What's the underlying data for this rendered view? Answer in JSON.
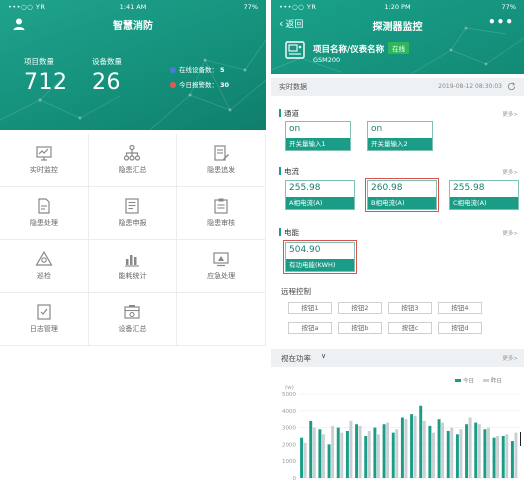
{
  "left": {
    "status": {
      "signal": "•••○○ YR",
      "time": "1:41 AM",
      "battery": "77%"
    },
    "title": "智慧消防",
    "stats": [
      {
        "label": "项目数量",
        "value": "712"
      },
      {
        "label": "设备数量",
        "value": "26"
      }
    ],
    "mini_stats": [
      {
        "label": "在线设备数：",
        "value": "5",
        "color": "#4a7bd8"
      },
      {
        "label": "今日报警数：",
        "value": "30",
        "color": "#e85a4f"
      }
    ],
    "menu": [
      {
        "label": "实时监控",
        "icon": "monitor-icon"
      },
      {
        "label": "隐患汇总",
        "icon": "hierarchy-icon"
      },
      {
        "label": "隐患追发",
        "icon": "edit-doc-icon"
      },
      {
        "label": "隐患处理",
        "icon": "doc-pen-icon"
      },
      {
        "label": "隐患申报",
        "icon": "report-icon"
      },
      {
        "label": "隐患审核",
        "icon": "clipboard-icon"
      },
      {
        "label": "巡检",
        "icon": "warning-icon"
      },
      {
        "label": "能耗统计",
        "icon": "bar-chart-icon"
      },
      {
        "label": "应急处理",
        "icon": "screen-icon"
      },
      {
        "label": "日志管理",
        "icon": "log-icon"
      },
      {
        "label": "设备汇总",
        "icon": "device-icon"
      }
    ]
  },
  "right": {
    "status": {
      "signal": "•••○○ YR",
      "time": "1:20 PM",
      "battery": "77%"
    },
    "back_label": "返回",
    "title": "探测器监控",
    "more_label": "•••",
    "device": {
      "name": "项目名称/仪表名称",
      "status": "在线",
      "model": "GSM200"
    },
    "realtime": {
      "label": "实时数据",
      "timestamp": "2019-08-12 08:30:03"
    },
    "more_link": "更多>",
    "sections": {
      "channel": {
        "title": "通道",
        "items": [
          {
            "value": "on",
            "name": "开关量输入1"
          },
          {
            "value": "on",
            "name": "开关量输入2"
          }
        ]
      },
      "current": {
        "title": "电流",
        "items": [
          {
            "value": "255.98",
            "name": "A相电流(A)"
          },
          {
            "value": "260.98",
            "name": "B相电流(A)",
            "alert": true
          },
          {
            "value": "255.98",
            "name": "C相电流(A)"
          }
        ]
      },
      "energy": {
        "title": "电能",
        "items": [
          {
            "value": "504.90",
            "name": "有功电能(KWH)",
            "alert": true
          }
        ]
      }
    },
    "remote": {
      "title": "远程控制",
      "buttons": [
        "按钮1",
        "按钮2",
        "按钮3",
        "按钮4",
        "按钮a",
        "按钮b",
        "按钮c",
        "按钮d"
      ]
    },
    "power": {
      "label": "视在功率",
      "chevron": "∨",
      "more": "更多>"
    },
    "chart_data": {
      "type": "bar",
      "ylabel": "(w)",
      "ylim": [
        0,
        5000
      ],
      "yticks": [
        0,
        1000,
        2000,
        3000,
        4000,
        5000
      ],
      "grid": true,
      "legend_position": "top-right",
      "series": [
        {
          "name": "今日",
          "color": "#1a9c86",
          "values": [
            2400,
            3400,
            2900,
            2000,
            3000,
            2800,
            3200,
            2500,
            3000,
            3200,
            2700,
            3600,
            3800,
            4300,
            3100,
            3500,
            2800,
            2600,
            3200,
            3300,
            2900,
            2400,
            2500,
            2200
          ]
        },
        {
          "name": "昨日",
          "color": "#c9cfd3",
          "values": [
            2100,
            3000,
            2600,
            3100,
            2700,
            3400,
            3100,
            2800,
            2600,
            3300,
            2900,
            3500,
            3700,
            3400,
            2700,
            3300,
            3000,
            2900,
            3600,
            3200,
            3000,
            2500,
            2600,
            2700
          ]
        }
      ]
    }
  }
}
